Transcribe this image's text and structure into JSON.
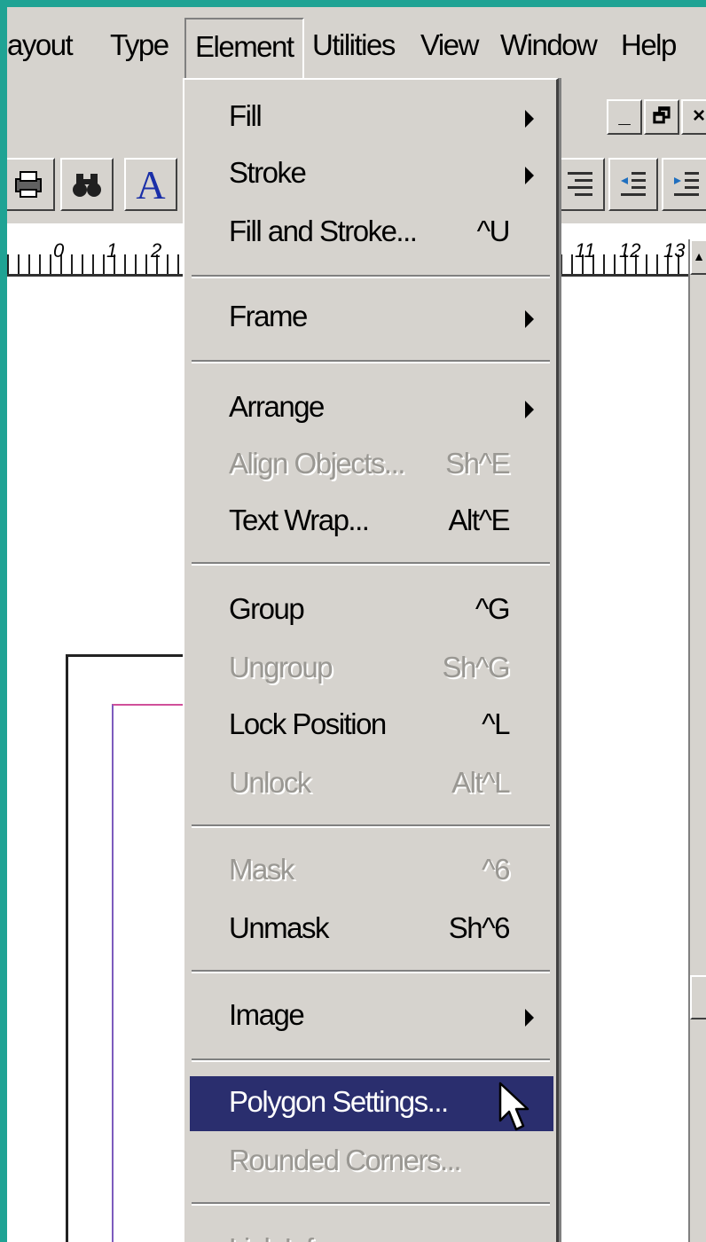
{
  "menubar": {
    "items": [
      {
        "label": "ayout"
      },
      {
        "label": "Type"
      },
      {
        "label": "Element"
      },
      {
        "label": "Utilities"
      },
      {
        "label": "View"
      },
      {
        "label": "Window"
      },
      {
        "label": "Help"
      }
    ],
    "active_index": 2
  },
  "window_controls": {
    "minimize": "_",
    "restore": "🗗",
    "close": "×"
  },
  "toolbar": {
    "text_tool_label": "A"
  },
  "ruler": {
    "numbers": [
      "0",
      "1",
      "2",
      "11",
      "12",
      "13"
    ]
  },
  "element_menu": {
    "items": [
      {
        "label": "Fill",
        "shortcut": "",
        "submenu": true,
        "enabled": true
      },
      {
        "label": "Stroke",
        "shortcut": "",
        "submenu": true,
        "enabled": true
      },
      {
        "label": "Fill and Stroke...",
        "shortcut": "^U",
        "submenu": false,
        "enabled": true
      },
      {
        "label": "Frame",
        "shortcut": "",
        "submenu": true,
        "enabled": true
      },
      {
        "label": "Arrange",
        "shortcut": "",
        "submenu": true,
        "enabled": true
      },
      {
        "label": "Align Objects...",
        "shortcut": "Sh^E",
        "submenu": false,
        "enabled": false
      },
      {
        "label": "Text Wrap...",
        "shortcut": "Alt^E",
        "submenu": false,
        "enabled": true
      },
      {
        "label": "Group",
        "shortcut": "^G",
        "submenu": false,
        "enabled": true
      },
      {
        "label": "Ungroup",
        "shortcut": "Sh^G",
        "submenu": false,
        "enabled": false
      },
      {
        "label": "Lock Position",
        "shortcut": "^L",
        "submenu": false,
        "enabled": true
      },
      {
        "label": "Unlock",
        "shortcut": "Alt^L",
        "submenu": false,
        "enabled": false
      },
      {
        "label": "Mask",
        "shortcut": "^6",
        "submenu": false,
        "enabled": false
      },
      {
        "label": "Unmask",
        "shortcut": "Sh^6",
        "submenu": false,
        "enabled": true
      },
      {
        "label": "Image",
        "shortcut": "",
        "submenu": true,
        "enabled": true
      },
      {
        "label": "Polygon Settings...",
        "shortcut": "",
        "submenu": false,
        "enabled": true,
        "selected": true
      },
      {
        "label": "Rounded Corners...",
        "shortcut": "",
        "submenu": false,
        "enabled": false
      },
      {
        "label": "Link Info...",
        "shortcut": "",
        "submenu": false,
        "enabled": false
      }
    ]
  },
  "colors": {
    "frame_accent": "#1fa394",
    "menu_bg": "#d6d3ce",
    "selection_bg": "#2a2e6e",
    "text_tool": "#1a2fa8"
  }
}
